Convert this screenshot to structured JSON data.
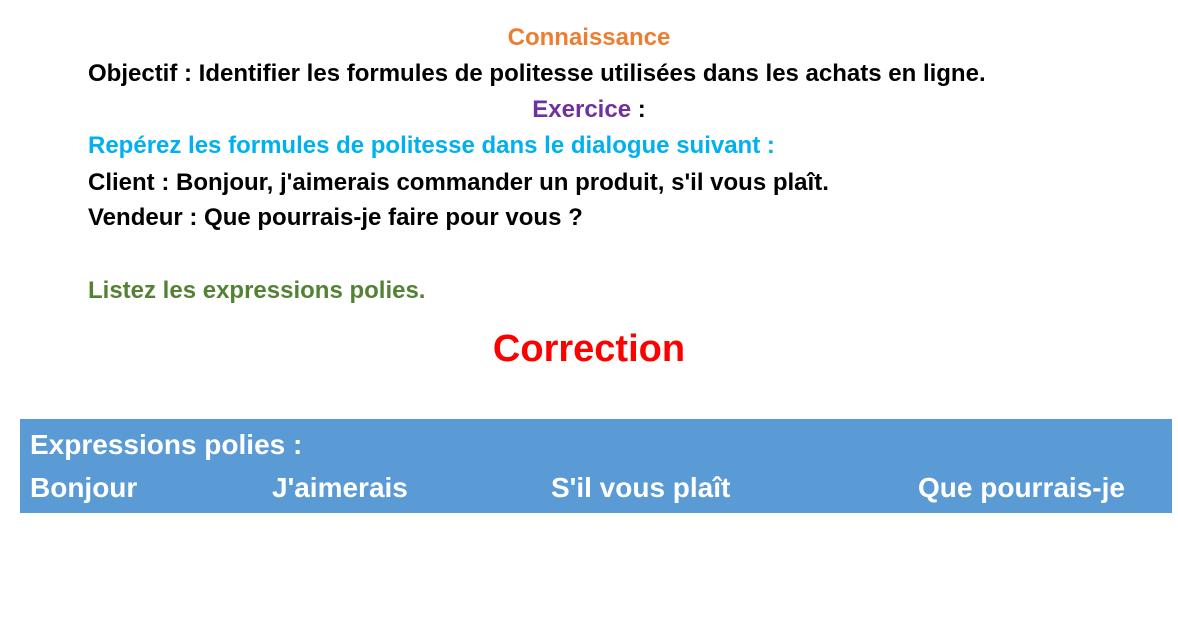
{
  "heading": "Connaissance",
  "objective": "Objectif : Identifier les formules de politesse utilisées dans les achats en ligne.",
  "exercise": {
    "label": "Exercice",
    "suffix": " :"
  },
  "instruction": "Repérez les formules de politesse dans le dialogue suivant :",
  "dialogue": {
    "client": "Client : Bonjour, j'aimerais commander un produit, s'il vous plaît.",
    "vendeur": "Vendeur : Que pourrais-je faire pour vous ?"
  },
  "task": "Listez les expressions polies.",
  "correction": {
    "title": "Correction",
    "box_title": "Expressions polies :",
    "expressions": [
      "Bonjour",
      "J'aimerais",
      "S'il vous plaît",
      "Que pourrais-je"
    ]
  },
  "colors": {
    "heading": "#ED7D31",
    "exercise": "#7030A0",
    "instruction": "#00B0F0",
    "task": "#548235",
    "correction": "#FF0000",
    "box": "#5B9BD5"
  }
}
